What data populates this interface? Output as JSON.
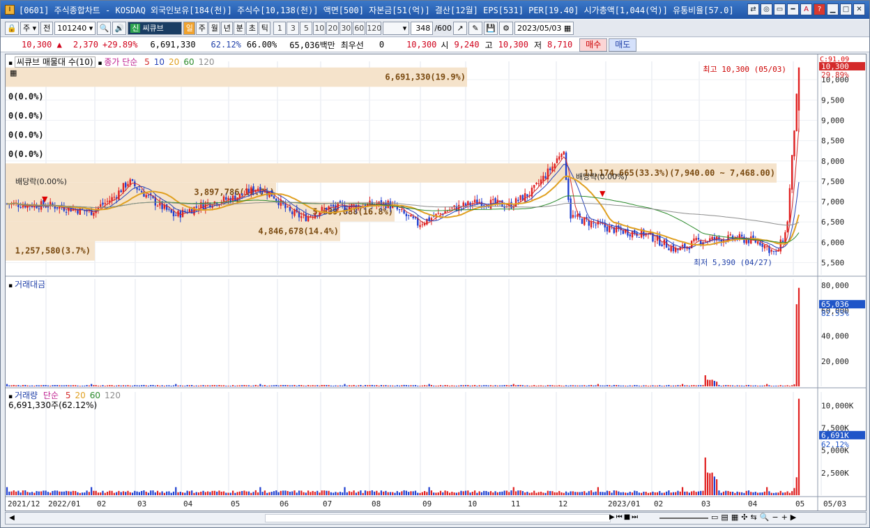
{
  "window": {
    "title": "[0601] 주식종합차트 - KOSDAQ 외국인보유[184(천)] 주식수[10,138(천)] 액면[500] 자본금[51(억)] 결산[12월] EPS[531] PER[19.40] 시가총액[1,044(억)] 유통비율[57.0]",
    "app_icon": "I"
  },
  "toolbar": {
    "type_label": "주",
    "all_label": "전",
    "code": "101240",
    "stock_badge": "신",
    "stock_name": "씨큐브",
    "period_buttons": [
      "일",
      "주",
      "월",
      "년",
      "분",
      "초",
      "틱"
    ],
    "period_selected": "일",
    "interval_buttons": [
      "1",
      "3",
      "5",
      "10",
      "20",
      "30",
      "60",
      "120"
    ],
    "count": "348",
    "count_total": "/600",
    "date": "2023/05/03"
  },
  "quote": {
    "price": "10,300",
    "change": "2,370",
    "change_pct": "+29.89%",
    "volume": "6,691,330",
    "turnover_pct": "62.12%",
    "ratio_pct": "66.00%",
    "amount": "65,036백만",
    "bid_label": "최우선",
    "bid_value": "0",
    "best_price": "10,300",
    "open_label": "시",
    "open": "9,240",
    "high_label": "고",
    "high": "10,300",
    "low_label": "저",
    "low": "8,710",
    "buy_label": "매수",
    "sell_label": "매도"
  },
  "price_panel": {
    "title": "씨큐브 매물대 수(10)",
    "ma_label": "종가 단순",
    "ma_periods": [
      "5",
      "10",
      "20",
      "60",
      "120"
    ],
    "ma_colors": [
      "#d42a2a",
      "#2441b8",
      "#e0a020",
      "#2a8a2a",
      "#8c8c8c"
    ],
    "corner_label": "C:91.09",
    "last_price": "10,300",
    "last_pct": "29.89%",
    "high_marker": "최고 10,300 (05/03)",
    "low_marker": "최저 5,390 (04/27)",
    "dividend_labels": [
      "배당락(0.00%)",
      "배당락(0.00%)"
    ],
    "yticks": [
      "10,000",
      "9,500",
      "9,000",
      "8,500",
      "8,000",
      "7,500",
      "7,000",
      "6,500",
      "6,000",
      "5,500"
    ],
    "volume_profile": [
      {
        "label": "6,691,330(19.9%)"
      },
      {
        "label": "0(0.0%)"
      },
      {
        "label": "0(0.0%)"
      },
      {
        "label": "0(0.0%)"
      },
      {
        "label": "0(0.0%)"
      },
      {
        "label": "11,174,665(33.3%)(7,940.00 ~ 7,468.00)"
      },
      {
        "label": "3,897,786(11.7%)"
      },
      {
        "label": "5,639,088(16.8%)"
      },
      {
        "label": "4,846,678(14.4%)"
      },
      {
        "label": "1,257,580(3.7%)"
      }
    ]
  },
  "amount_panel": {
    "title": "거래대금",
    "yticks": [
      "80,000",
      "60,000",
      "40,000",
      "20,000"
    ],
    "last_value": "65,036",
    "last_pct": "82.55%"
  },
  "volume_panel": {
    "title": "거래량",
    "ma_label": "단순",
    "ma_periods": [
      "5",
      "20",
      "60",
      "120"
    ],
    "ma_colors": [
      "#d42a2a",
      "#e0a020",
      "#2a8a2a",
      "#8c8c8c"
    ],
    "value_label": "6,691,330주(62.12%)",
    "yticks": [
      "10,000K",
      "7,500K",
      "5,000K",
      "2,500K"
    ],
    "last_value": "6,691K",
    "last_pct": "62.12%"
  },
  "xaxis": {
    "labels": [
      "2021/12",
      "2022/01",
      "02",
      "03",
      "04",
      "05",
      "06",
      "07",
      "08",
      "09",
      "10",
      "11",
      "12",
      "2023/01",
      "02",
      "03",
      "04",
      "05",
      "05/03"
    ]
  },
  "colors": {
    "up": "#e02020",
    "down": "#1f3fd0",
    "profile": "#f5e3cb",
    "title_bar": "#2a62b8"
  }
}
